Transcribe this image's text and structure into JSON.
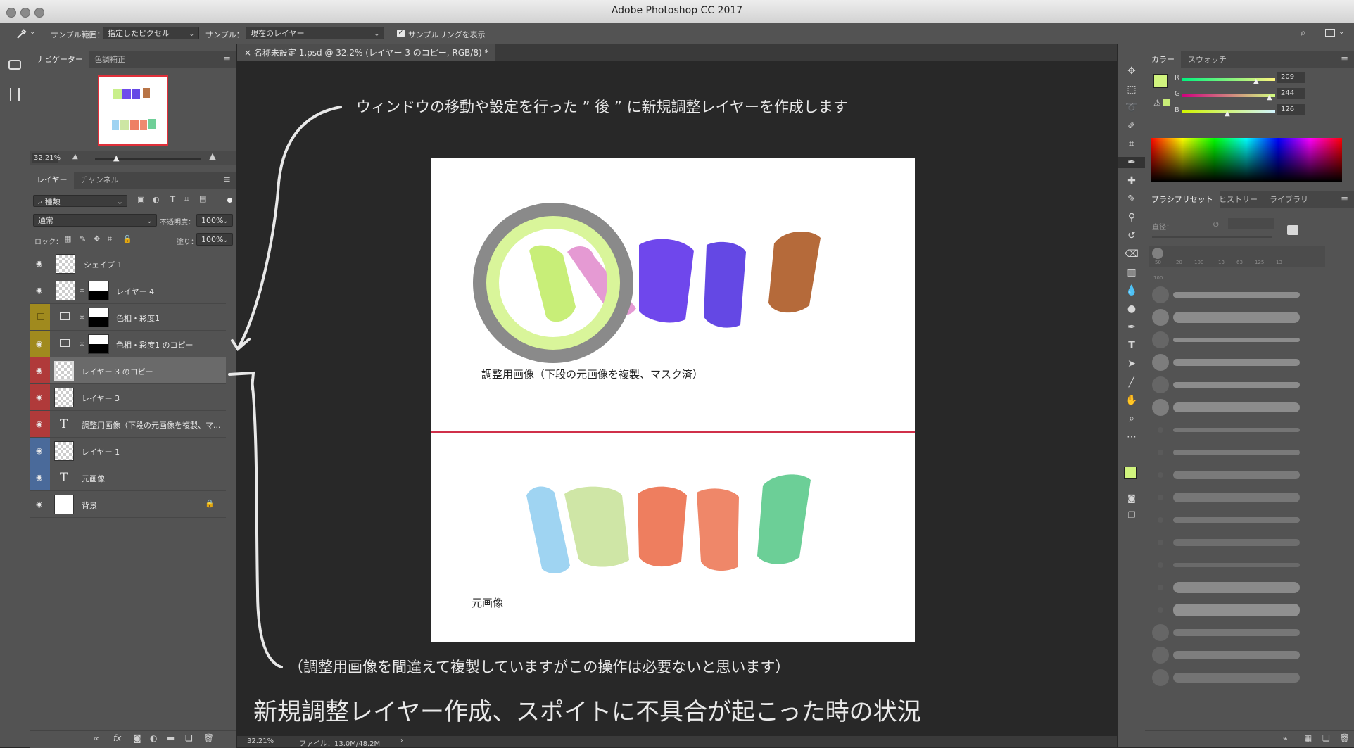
{
  "window": {
    "title": "Adobe Photoshop CC 2017"
  },
  "options_bar": {
    "sample_size_label": "サンプル範囲：",
    "sample_size_value": "指定したピクセル",
    "sample_label": "サンプル：",
    "sample_value": "現在のレイヤー",
    "show_ring_label": "サンプルリングを表示"
  },
  "left_panels": {
    "navigator_tabs": [
      "ナビゲーター",
      "色調補正"
    ],
    "zoom": "32.21%",
    "layers_tabs": [
      "レイヤー",
      "チャンネル"
    ],
    "filter_kind": "種類",
    "blend_mode": "通常",
    "opacity_label": "不透明度：",
    "opacity_value": "100%",
    "lock_label": "ロック：",
    "fill_label": "塗り：",
    "fill_value": "100%",
    "layers": [
      {
        "name": "シェイプ 1",
        "type": "shape",
        "color": ""
      },
      {
        "name": "レイヤー 4",
        "type": "masked",
        "color": ""
      },
      {
        "name": "色相・彩度1",
        "type": "adjustment",
        "color": "#a08a1e"
      },
      {
        "name": "色相・彩度1 のコピー",
        "type": "adjustment",
        "color": "#a08a1e"
      },
      {
        "name": "レイヤー 3 のコピー",
        "type": "pixel",
        "color": "#b03a3a",
        "selected": true
      },
      {
        "name": "レイヤー 3",
        "type": "pixel",
        "color": "#b03a3a"
      },
      {
        "name": "調整用画像（下段の元画像を複製、マ...",
        "type": "text",
        "color": "#b03a3a"
      },
      {
        "name": "レイヤー 1",
        "type": "pixel",
        "color": "#4a6a9a"
      },
      {
        "name": "元画像",
        "type": "text",
        "color": "#4a6a9a"
      },
      {
        "name": "背景",
        "type": "background",
        "color": ""
      }
    ]
  },
  "document": {
    "tab_title": "名称未設定 1.psd @ 32.2% (レイヤー 3 のコピー, RGB/8) *",
    "upper_caption": "調整用画像（下段の元画像を複製、マスク済）",
    "lower_caption": "元画像",
    "status_zoom": "32.21%",
    "status_file": "ファイル：13.0M/48.2M"
  },
  "annotations": {
    "top_note": "ウィンドウの移動や設定を行った ” 後 ” に新規調整レイヤーを作成します",
    "middle_note": "（調整用画像を間違えて複製していますがこの操作は必要ないと思います）",
    "headline": "新規調整レイヤー作成、スポイトに不具合が起こった時の状況"
  },
  "right_panels": {
    "color_tabs": [
      "カラー",
      "スウォッチ"
    ],
    "r_label": "R",
    "r_value": "209",
    "g_label": "G",
    "g_value": "244",
    "b_label": "B",
    "b_value": "126",
    "foreground_color": "#d1f47e",
    "brush_tabs": [
      "ブラシプリセット",
      "ヒストリー",
      "ライブラリ"
    ],
    "diameter_label": "直径：",
    "brush_sizes": [
      "50",
      "20",
      "100",
      "13",
      "63",
      "125",
      "13"
    ],
    "brush_row_size": "100"
  }
}
